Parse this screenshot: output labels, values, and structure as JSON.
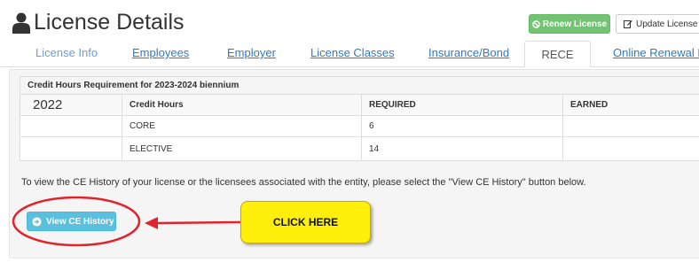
{
  "header": {
    "title": "License Details",
    "title_icon": "user-icon",
    "renew_label": "Renew License",
    "update_label": "Update License"
  },
  "tabs": [
    {
      "label": "License Info"
    },
    {
      "label": "Employees"
    },
    {
      "label": "Employer"
    },
    {
      "label": "License Classes"
    },
    {
      "label": "Insurance/Bond"
    },
    {
      "label": "RECE",
      "active": true
    },
    {
      "label": "Online Renewal H"
    }
  ],
  "table": {
    "caption": "Credit Hours Requirement for 2023-2024 biennium",
    "headers": [
      "2022",
      "Credit Hours",
      "REQUIRED",
      "EARNED"
    ],
    "rows": [
      [
        "",
        "CORE",
        "6",
        ""
      ],
      [
        "",
        "ELECTIVE",
        "14",
        ""
      ]
    ]
  },
  "instruction": "To view the CE History of your license or the licensees associated with the entity, please select the \"View CE History\" button below.",
  "view_ce_button": {
    "label": "View CE History",
    "icon": "arrow-circle-right-icon"
  },
  "annotation": {
    "callout": "CLICK HERE",
    "arrow_color": "#e0242b",
    "callout_color": "#ffef0a"
  },
  "colors": {
    "renew": "#5cb85c",
    "ce_button": "#5bc0de",
    "link": "#337ab7"
  }
}
